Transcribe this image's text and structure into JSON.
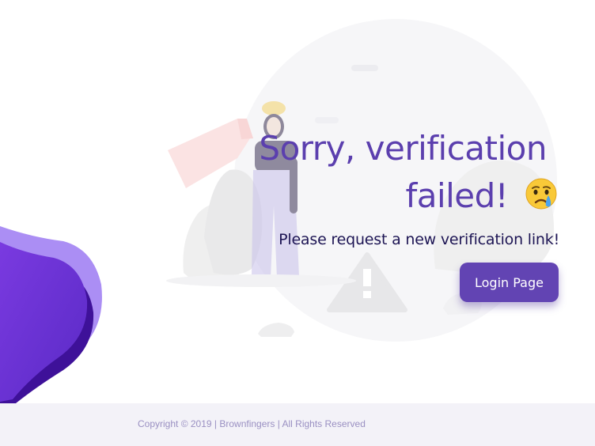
{
  "colors": {
    "heading": "#5b3fae",
    "subtext": "#1d1554",
    "button_bg": "#6244b3",
    "button_text": "#ffffff",
    "footer_bg": "#f3f2f8",
    "footer_text": "#9a90c2",
    "blob_light": "#a98cf2",
    "blob_mid": "#6a35d6",
    "blob_dark": "#3a0d8c"
  },
  "message": {
    "title_line1": "Sorry, verification",
    "title_line2": "failed!",
    "emoji_icon": "crying-face-icon",
    "subtitle": "Please request a new verification link!"
  },
  "actions": {
    "login_label": "Login Page"
  },
  "footer": {
    "copyright": "Copyright © 2019 | Brownfingers | All Rights Reserved"
  },
  "illustration": {
    "icons": [
      "warning-icon",
      "flag-icon",
      "worker-figure",
      "rocks",
      "purple-wave-blob"
    ]
  }
}
